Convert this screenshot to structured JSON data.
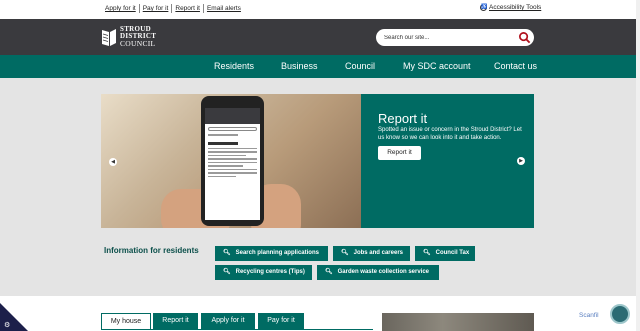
{
  "utility": {
    "links": [
      "Apply for it",
      "Pay for it",
      "Report it",
      "Email alerts"
    ],
    "accessibility": "Accessibility Tools"
  },
  "logo": {
    "line1": "STROUD",
    "line2": "DISTRICT",
    "line3": "COUNCIL"
  },
  "search": {
    "placeholder": "Search our site..."
  },
  "nav": [
    "Residents",
    "Business",
    "Council",
    "My SDC account",
    "Contact us"
  ],
  "hero": {
    "title": "Report it",
    "text": "Spotted an issue or concern in the Stroud District? Let us know so we can look into it and take action.",
    "button": "Report it"
  },
  "info": {
    "title": "Information for residents",
    "buttons": [
      "Search planning applications",
      "Jobs and careers",
      "Council Tax",
      "Recycling centres (Tips)",
      "Garden waste collection service"
    ]
  },
  "tabs": [
    "My house",
    "Report it",
    "Apply for it",
    "Pay for it"
  ],
  "badges": {
    "scanfil": "Scanfil"
  },
  "colors": {
    "teal": "#006b63",
    "header": "#3a3a3e",
    "navy": "#1c1f4a"
  },
  "icons": {
    "search": "search-icon",
    "cookie": "cookie-settings-icon",
    "accessibility": "accessibility-icon"
  }
}
